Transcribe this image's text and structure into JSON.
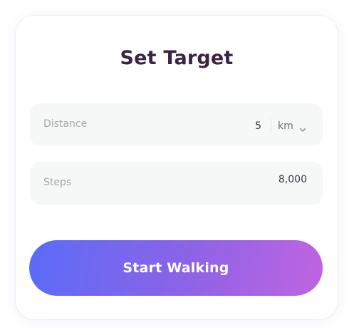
{
  "card": {
    "title": "Set Target"
  },
  "distance": {
    "label": "Distance",
    "value": "5",
    "unit": "km",
    "unit_icon": "chevron-down-icon"
  },
  "steps": {
    "label": "Steps",
    "value": "8,000"
  },
  "actions": {
    "start_label": "Start Walking"
  },
  "colors": {
    "title": "#3a2443",
    "field_background": "#f6f7f7",
    "label": "#a4a7ab",
    "gradient_start": "#5a6cf8",
    "gradient_end": "#c064e0"
  }
}
